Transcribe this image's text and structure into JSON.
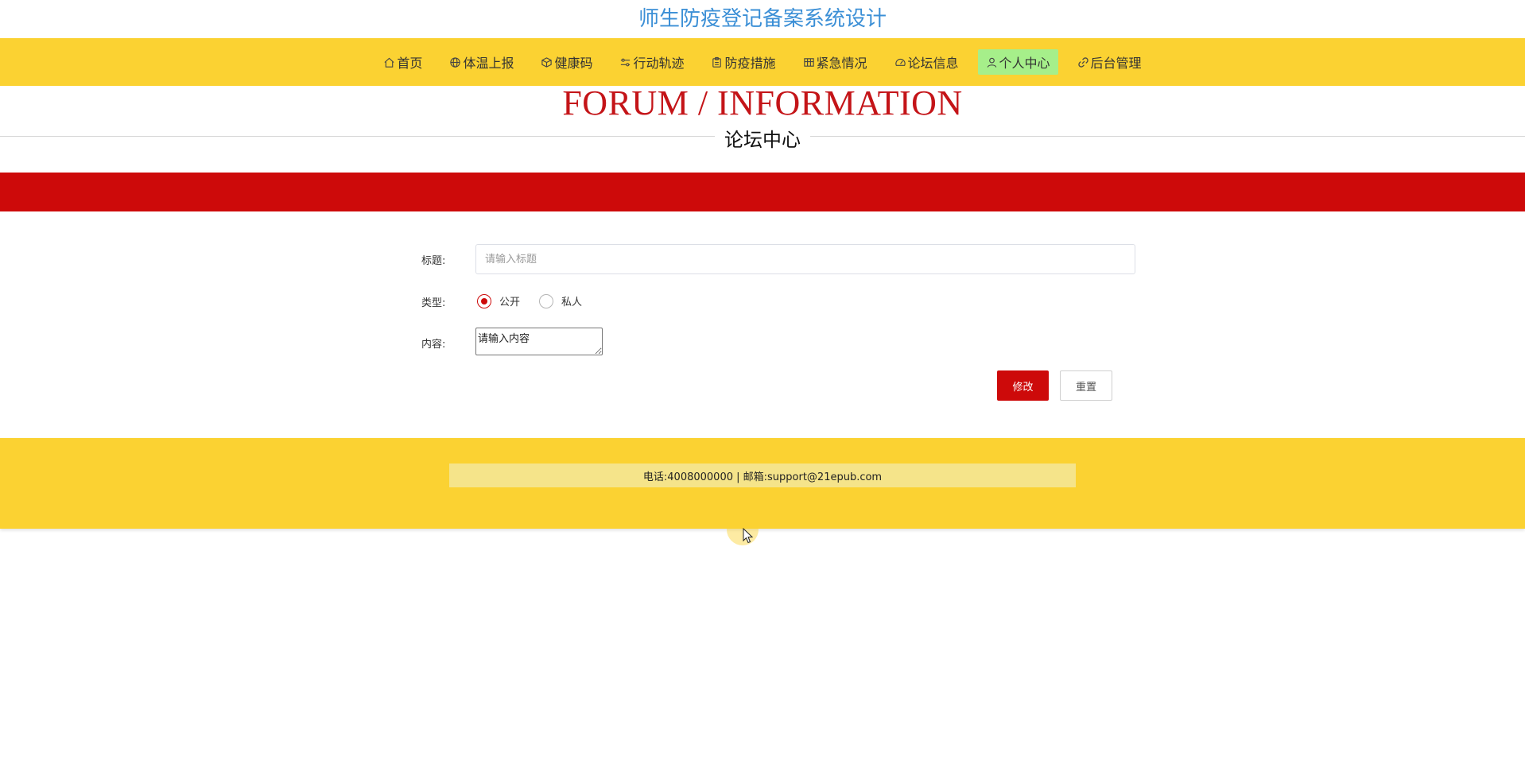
{
  "site": {
    "title": "师生防疫登记备案系统设计"
  },
  "nav": {
    "items": [
      {
        "label": "首页",
        "icon": "home-icon"
      },
      {
        "label": "体温上报",
        "icon": "globe-icon"
      },
      {
        "label": "健康码",
        "icon": "cube-icon"
      },
      {
        "label": "行动轨迹",
        "icon": "sliders-icon"
      },
      {
        "label": "防疫措施",
        "icon": "clipboard-icon"
      },
      {
        "label": "紧急情况",
        "icon": "grid-icon"
      },
      {
        "label": "论坛信息",
        "icon": "gauge-icon"
      },
      {
        "label": "个人中心",
        "icon": "user-icon",
        "active": true
      },
      {
        "label": "后台管理",
        "icon": "link-icon"
      }
    ]
  },
  "heading": {
    "en": "FORUM / INFORMATION",
    "cn": "论坛中心"
  },
  "form": {
    "title_label": "标题:",
    "title_placeholder": "请输入标题",
    "type_label": "类型:",
    "type_options": [
      "公开",
      "私人"
    ],
    "type_selected": "公开",
    "content_label": "内容:",
    "content_placeholder": "请输入内容",
    "submit_label": "修改",
    "reset_label": "重置"
  },
  "footer": {
    "contact": "电话:4008000000 | 邮箱:support@21epub.com"
  },
  "colors": {
    "accent": "#cd0a0a",
    "nav_bg": "#fbd232",
    "active_nav": "#a6ef8a",
    "title_blue": "#3b8fd6"
  }
}
